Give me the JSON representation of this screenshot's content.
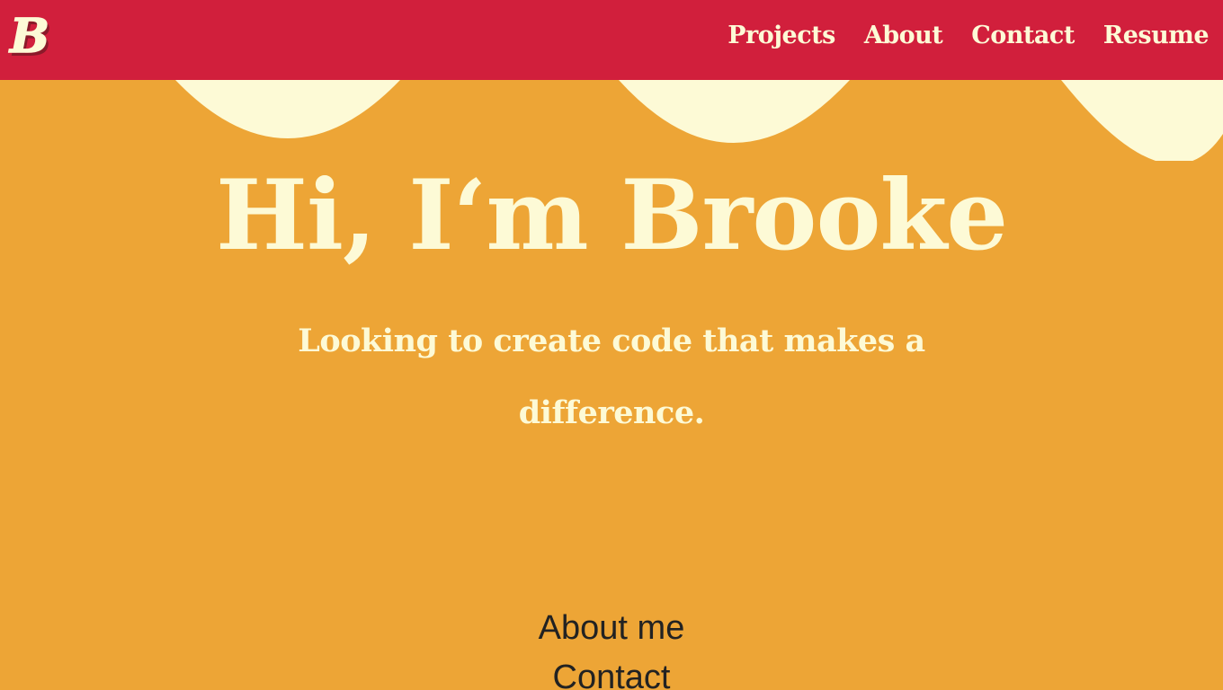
{
  "nav": {
    "logo_letter": "B",
    "links": [
      {
        "label": "Projects"
      },
      {
        "label": "About"
      },
      {
        "label": "Contact"
      },
      {
        "label": "Resume"
      }
    ]
  },
  "hero": {
    "title": "Hi, I‘m Brooke",
    "tagline": "Looking to create code that makes a difference."
  },
  "section_links": [
    {
      "label": "About me"
    },
    {
      "label": "Contact"
    }
  ],
  "colors": {
    "navbar": "#D11F3C",
    "background": "#EDA536",
    "cream": "#FDFAD6",
    "text_dark": "#222222"
  }
}
